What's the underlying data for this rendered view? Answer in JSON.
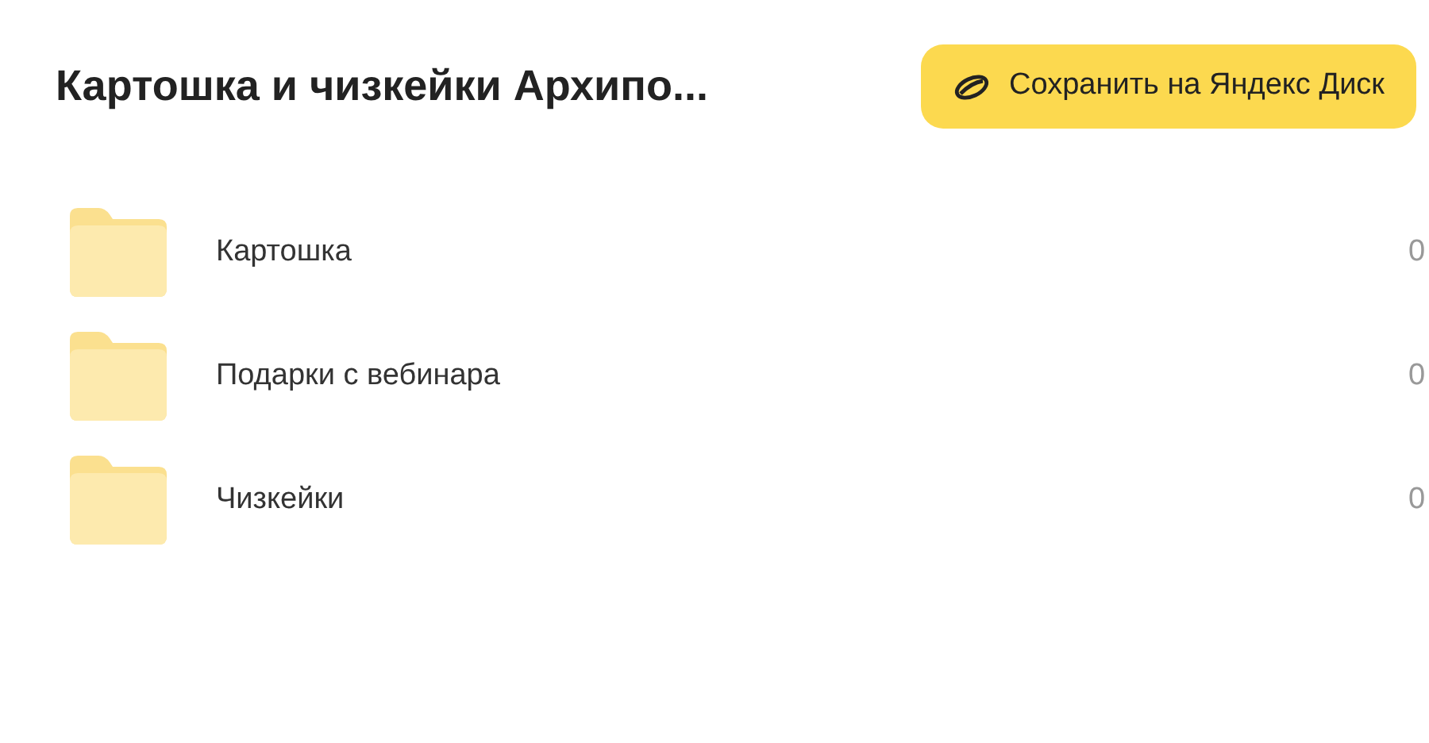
{
  "title": "Картошка и чизкейки Архипо...",
  "save_button": {
    "label": "Сохранить на Яндекс Диск"
  },
  "items": [
    {
      "name": "Картошка",
      "column_2": "0"
    },
    {
      "name": "Подарки с вебинара",
      "column_2": "0"
    },
    {
      "name": "Чизкейки",
      "column_2": "0"
    }
  ]
}
